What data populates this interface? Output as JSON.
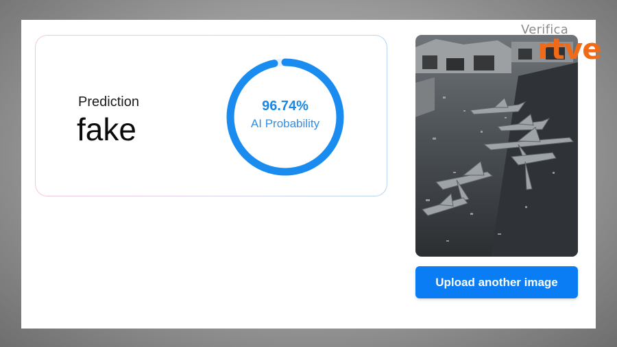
{
  "prediction": {
    "label": "Prediction",
    "value": "fake"
  },
  "probability": {
    "percent_text": "96.74%",
    "label": "AI Probability",
    "value": 0.9674,
    "color": "#1a8cf0"
  },
  "image": {
    "subject": "destroyed fighter jets at airfield"
  },
  "actions": {
    "upload_label": "Upload another image"
  },
  "watermark": {
    "line1": "Verifica",
    "line2": "rtve",
    "brand_color": "#f06a18"
  }
}
